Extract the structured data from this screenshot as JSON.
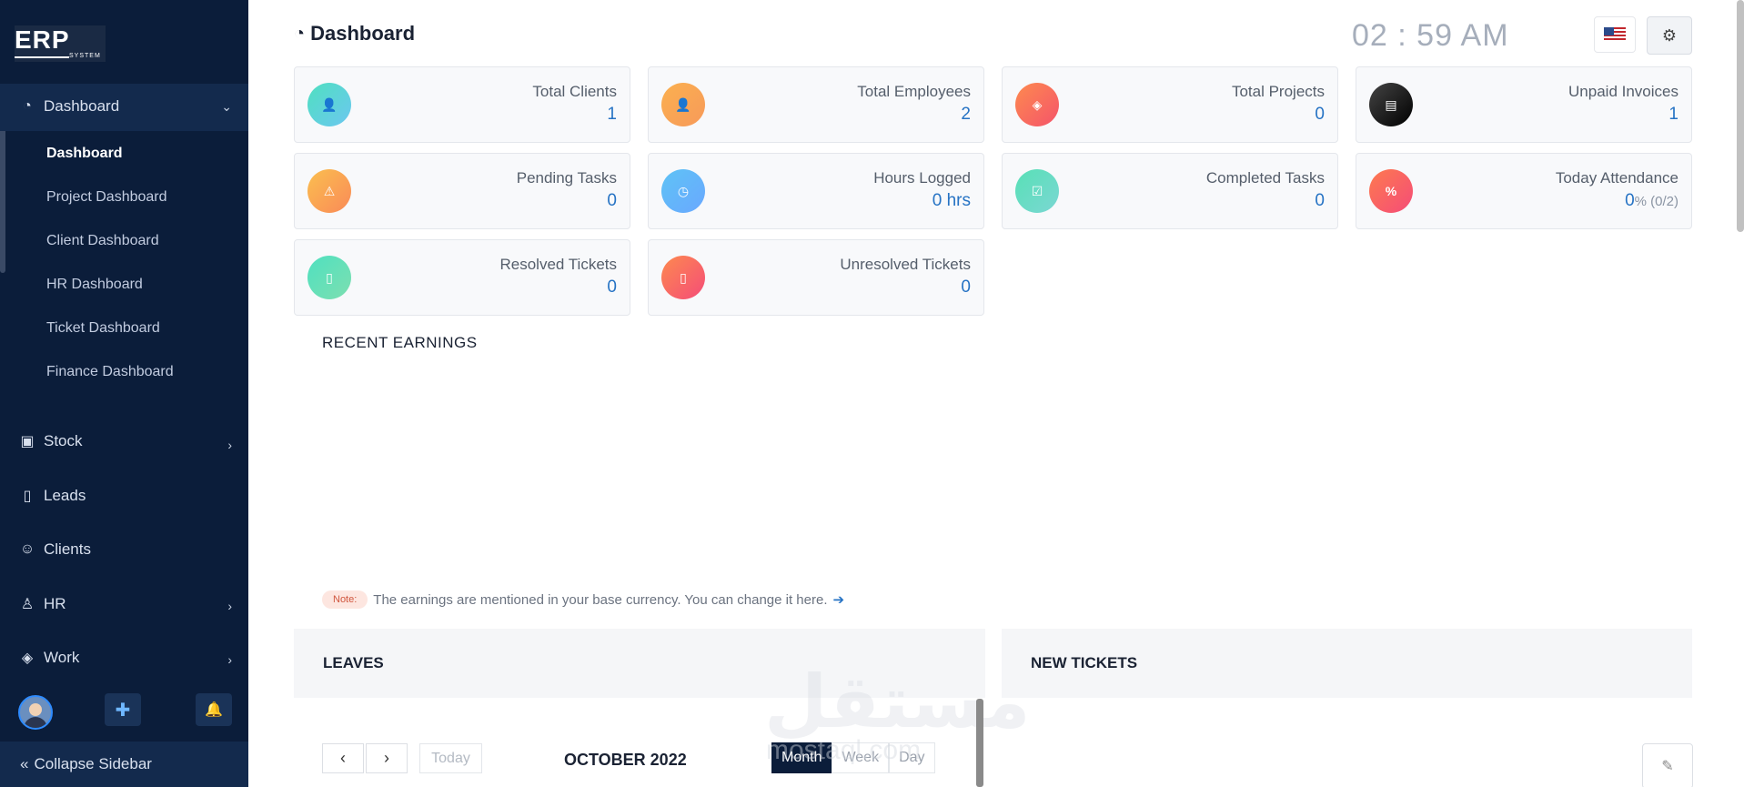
{
  "logo": {
    "main": "ERP",
    "sub": "SYSTEM"
  },
  "sidebar": {
    "parent": "Dashboard",
    "sub_items": [
      "Dashboard",
      "Project Dashboard",
      "Client Dashboard",
      "HR Dashboard",
      "Ticket Dashboard",
      "Finance Dashboard"
    ],
    "items": [
      "Stock",
      "Leads",
      "Clients",
      "HR",
      "Work"
    ],
    "collapse": "Collapse Sidebar",
    "add_symbol": "✚",
    "bell_symbol": "🔔"
  },
  "header": {
    "title": "Dashboard",
    "clock": "02 : 59 AM"
  },
  "cards": [
    {
      "label": "Total Clients",
      "value": "1",
      "sub": "",
      "icon": "user-icon",
      "glyph": "👤",
      "color1": "#4fe0c0",
      "color2": "#6cc7f0"
    },
    {
      "label": "Total Employees",
      "value": "2",
      "sub": "",
      "icon": "user-icon",
      "glyph": "👤",
      "color1": "#fbb04f",
      "color2": "#f79a5a"
    },
    {
      "label": "Total Projects",
      "value": "0",
      "sub": "",
      "icon": "layers-icon",
      "glyph": "◈",
      "color1": "#fd8a4f",
      "color2": "#f5546a"
    },
    {
      "label": "Unpaid Invoices",
      "value": "1",
      "sub": "",
      "icon": "invoice-icon",
      "glyph": "▤",
      "color1": "#444444",
      "color2": "#000000"
    },
    {
      "label": "Pending Tasks",
      "value": "0",
      "sub": "",
      "icon": "warning-icon",
      "glyph": "⚠",
      "color1": "#fbbf4f",
      "color2": "#f98a58"
    },
    {
      "label": "Hours Logged",
      "value": "0 hrs",
      "sub": "",
      "icon": "clock-icon",
      "glyph": "◷",
      "color1": "#5ec3f5",
      "color2": "#6aa8ff"
    },
    {
      "label": "Completed Tasks",
      "value": "0",
      "sub": "",
      "icon": "check-icon",
      "glyph": "☑",
      "color1": "#58e0b6",
      "color2": "#7bd7d3"
    },
    {
      "label": "Today Attendance",
      "value": "0",
      "sub": "% (0/2)",
      "icon": "percent-icon",
      "glyph": "%",
      "color1": "#fd7a4f",
      "color2": "#f54c78"
    },
    {
      "label": "Resolved Tickets",
      "value": "0",
      "sub": "",
      "icon": "ticket-icon",
      "glyph": "▯",
      "color1": "#4fe0c0",
      "color2": "#7ddfb0"
    },
    {
      "label": "Unresolved Tickets",
      "value": "0",
      "sub": "",
      "icon": "ticket-icon",
      "glyph": "▯",
      "color1": "#fd8a4f",
      "color2": "#f54c78"
    }
  ],
  "earnings": {
    "title": "RECENT EARNINGS",
    "note_tag": "Note:",
    "note_text": "The earnings are mentioned in your base currency. You can change it here."
  },
  "leaves": {
    "title": "LEAVES",
    "today": "Today",
    "month": "OCTOBER 2022",
    "views": [
      "Month",
      "Week",
      "Day"
    ]
  },
  "tickets": {
    "title": "NEW TICKETS"
  },
  "watermark": {
    "main": "مستقل",
    "sub": "mostaql.com"
  }
}
